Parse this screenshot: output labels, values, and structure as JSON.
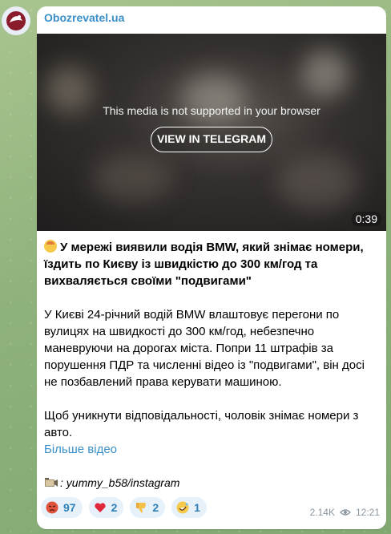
{
  "channel": {
    "name": "Obozrevatel.ua",
    "avatar_icon": "obozrevatel-logo"
  },
  "media": {
    "unsupported_text": "This media is not supported in your browser",
    "view_button": "VIEW IN TELEGRAM",
    "duration": "0:39"
  },
  "post": {
    "headline": "У мережі виявили водія BMW, який знімає номери, їздить по Києву із швидкістю до 300 км/год та вихваляється своїми \"подвигами\"",
    "paragraph1": "У Києві 24-річний водій BMW влаштовує перегони по вулицях на швидкості до 300 км/год, небезпечно маневруючи на дорогах міста. Попри 11 штрафів за порушення ПДР та численні відео із \"подвигами\", він досі не позбавлений права керувати машиною.",
    "paragraph2": "Щоб уникнути відповідальності, чоловік знімає номери з авто.",
    "more_link": "Більше відео",
    "source": ": yummy_b58/instagram"
  },
  "reactions": [
    {
      "emoji": "angry-face",
      "count": "97"
    },
    {
      "emoji": "red-heart",
      "count": "2"
    },
    {
      "emoji": "thumbs-down",
      "count": "2"
    },
    {
      "emoji": "rofl-face",
      "count": "1"
    }
  ],
  "meta": {
    "views": "2.14K",
    "time": "12:21"
  },
  "colors": {
    "link": "#3a8fc8",
    "reaction_bg": "#e6f1f9",
    "meta_gray": "#8a959e"
  }
}
